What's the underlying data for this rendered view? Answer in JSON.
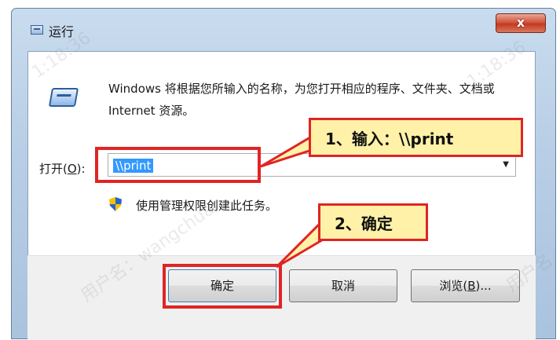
{
  "window": {
    "title": "运行",
    "close_label": "x"
  },
  "body": {
    "description": "Windows 将根据您所输入的名称，为您打开相应的程序、文件夹、文档或 Internet 资源。",
    "open_label_prefix": "打开(",
    "open_label_key": "O",
    "open_label_suffix": "):",
    "input_value": "\\\\print",
    "uac_text": "使用管理权限创建此任务。"
  },
  "buttons": {
    "ok": "确定",
    "cancel": "取消",
    "browse_prefix": "浏览(",
    "browse_key": "B",
    "browse_suffix": ")..."
  },
  "annotations": {
    "step1": "1、输入：\\\\print",
    "step2": "2、确定"
  },
  "watermarks": [
    "1:18:36",
    "1:18:36",
    "用户名：wangchuan",
    "用户名"
  ],
  "colors": {
    "highlight": "#e02424",
    "callout_fill": "#fff2a8",
    "selection": "#3399ff"
  }
}
